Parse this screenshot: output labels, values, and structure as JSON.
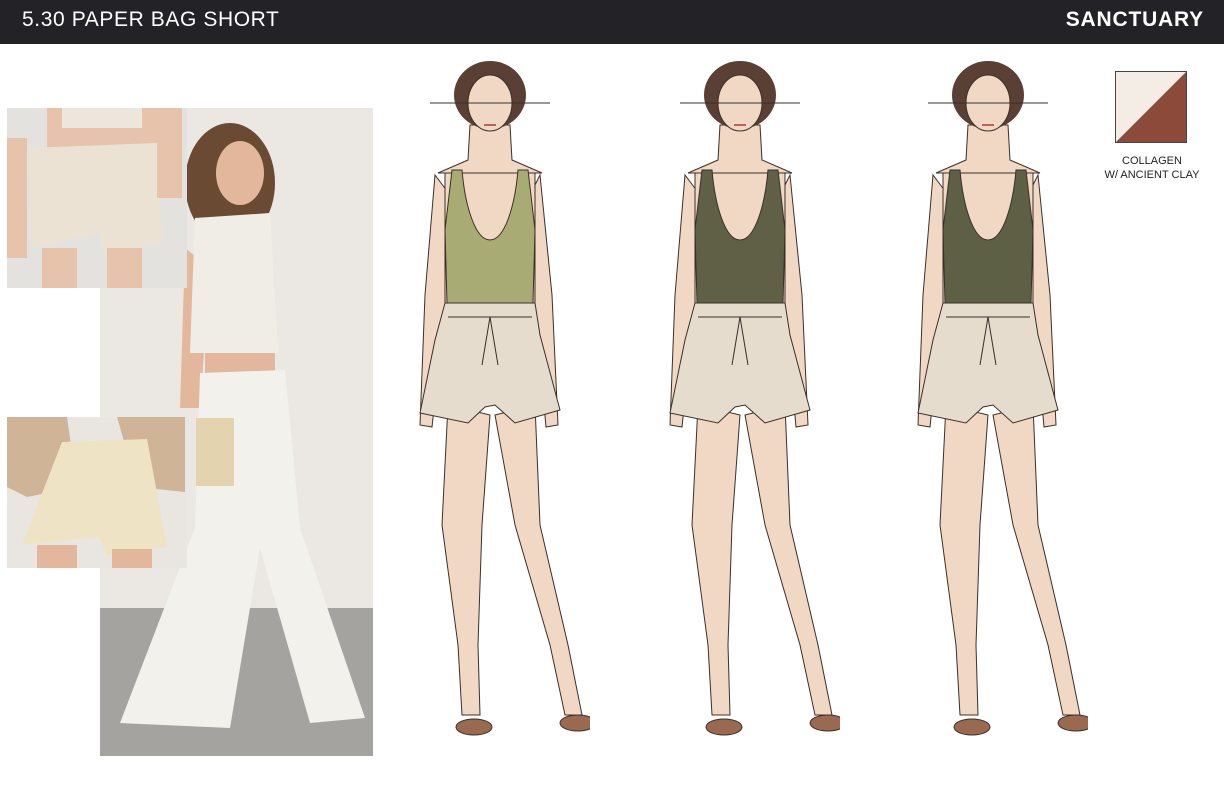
{
  "header": {
    "title": "5.30 PAPER BAG SHORT",
    "brand": "SANCTUARY"
  },
  "colorway": {
    "line1": "COLLAGEN",
    "line2": "W/ ANCIENT CLAY",
    "color_light": "#f4ede5",
    "color_dark": "#8b4a3a"
  },
  "figures": [
    {
      "top_color": "#a9ab74",
      "short_color": "#e6dccd"
    },
    {
      "top_color": "#5f6046",
      "short_color": "#e6dccd"
    },
    {
      "top_color": "#5e6046",
      "short_color": "#e6dccd"
    }
  ],
  "palette": {
    "skin": "#f1d8c4",
    "hair": "#5a3f34",
    "sandal": "#9a6a50"
  }
}
